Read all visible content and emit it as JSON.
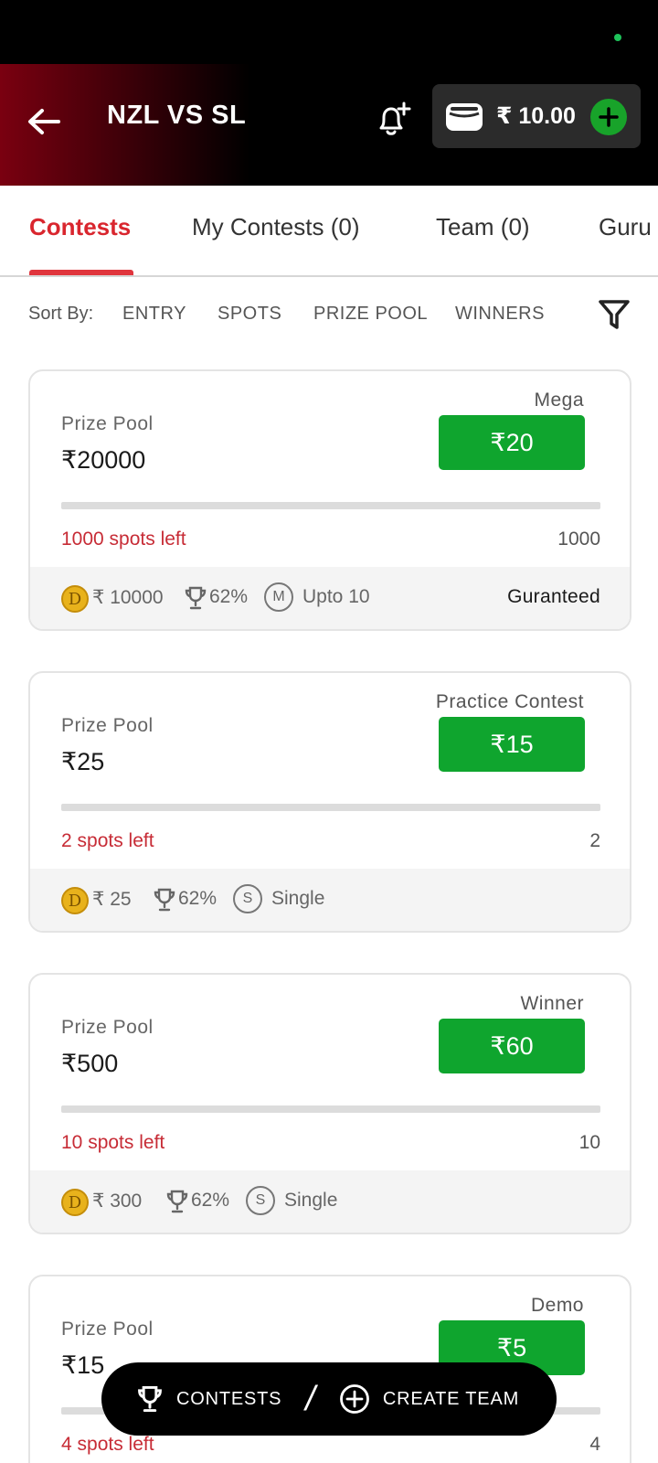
{
  "header": {
    "title": "NZL VS SL",
    "wallet_amount": "₹ 10.00",
    "accent_color": "#18a32a"
  },
  "tabs": [
    {
      "label": "Contests",
      "active": true
    },
    {
      "label": "My Contests (0)",
      "active": false
    },
    {
      "label": "Team (0)",
      "active": false
    },
    {
      "label": "Guru",
      "active": false
    }
  ],
  "sort": {
    "label": "Sort By:",
    "options": [
      "ENTRY",
      "SPOTS",
      "PRIZE POOL",
      "WINNERS"
    ]
  },
  "contests": [
    {
      "type": "Mega",
      "prize_label": "Prize Pool",
      "prize": "₹20000",
      "entry": "₹20",
      "spots_left": "1000 spots left",
      "spots_total": "1000",
      "coin_letter": "D",
      "first_prize": "₹ 10000",
      "winners_pct": "62%",
      "entry_badge": "M",
      "entry_limit": "Upto 10",
      "guarantee": "Guranteed"
    },
    {
      "type": "Practice Contest",
      "prize_label": "Prize Pool",
      "prize": "₹25",
      "entry": "₹15",
      "spots_left": "2 spots left",
      "spots_total": "2",
      "coin_letter": "D",
      "first_prize": "₹ 25",
      "winners_pct": "62%",
      "entry_badge": "S",
      "entry_limit": "Single"
    },
    {
      "type": "Winner",
      "prize_label": "Prize Pool",
      "prize": "₹500",
      "entry": "₹60",
      "spots_left": "10 spots left",
      "spots_total": "10",
      "coin_letter": "D",
      "first_prize": "₹ 300",
      "winners_pct": "62%",
      "entry_badge": "S",
      "entry_limit": "Single"
    },
    {
      "type": "Demo",
      "prize_label": "Prize Pool",
      "prize": "₹15",
      "entry": "₹5",
      "spots_left": "4 spots left",
      "spots_total": "4"
    }
  ],
  "bottom_bar": {
    "contests_label": "CONTESTS",
    "separator": "/",
    "create_label": "CREATE TEAM"
  }
}
